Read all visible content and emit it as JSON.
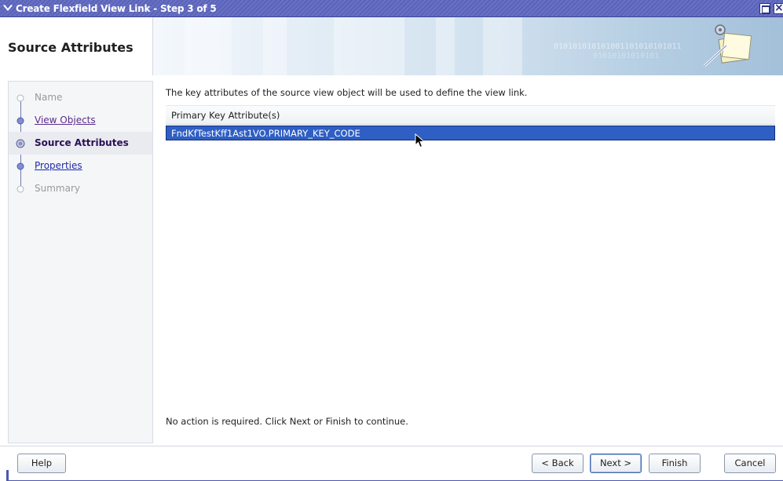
{
  "window": {
    "title": "Create Flexfield View Link - Step 3 of 5",
    "menu_icon": "chevron-down-icon",
    "maximize_icon": "maximize-icon",
    "close_icon": "close-icon"
  },
  "header": {
    "heading": "Source Attributes",
    "banner_binary_1": "010101010101001101010101011",
    "banner_binary_2": "01010101010101",
    "banner_icon": "wizard-gear-icon"
  },
  "steps": [
    {
      "label": "Name",
      "state": "disabled"
    },
    {
      "label": "View Objects",
      "state": "visited"
    },
    {
      "label": "Source Attributes",
      "state": "current"
    },
    {
      "label": "Properties",
      "state": "link"
    },
    {
      "label": "Summary",
      "state": "disabled"
    }
  ],
  "main": {
    "intro": "The key attributes of the source view object will be used to define the view link.",
    "table": {
      "column_header": "Primary Key Attribute(s)",
      "rows": [
        "FndKfTestKff1Ast1VO.PRIMARY_KEY_CODE"
      ]
    },
    "hint": "No action is required. Click Next or Finish to continue."
  },
  "footer": {
    "help": "Help",
    "back": "< Back",
    "next": "Next >",
    "finish": "Finish",
    "cancel": "Cancel"
  },
  "colors": {
    "title_bar": "#5a63b8",
    "selection": "#2f5fc4",
    "link": "#1d2aa8",
    "visited_link": "#5b2c8c"
  }
}
